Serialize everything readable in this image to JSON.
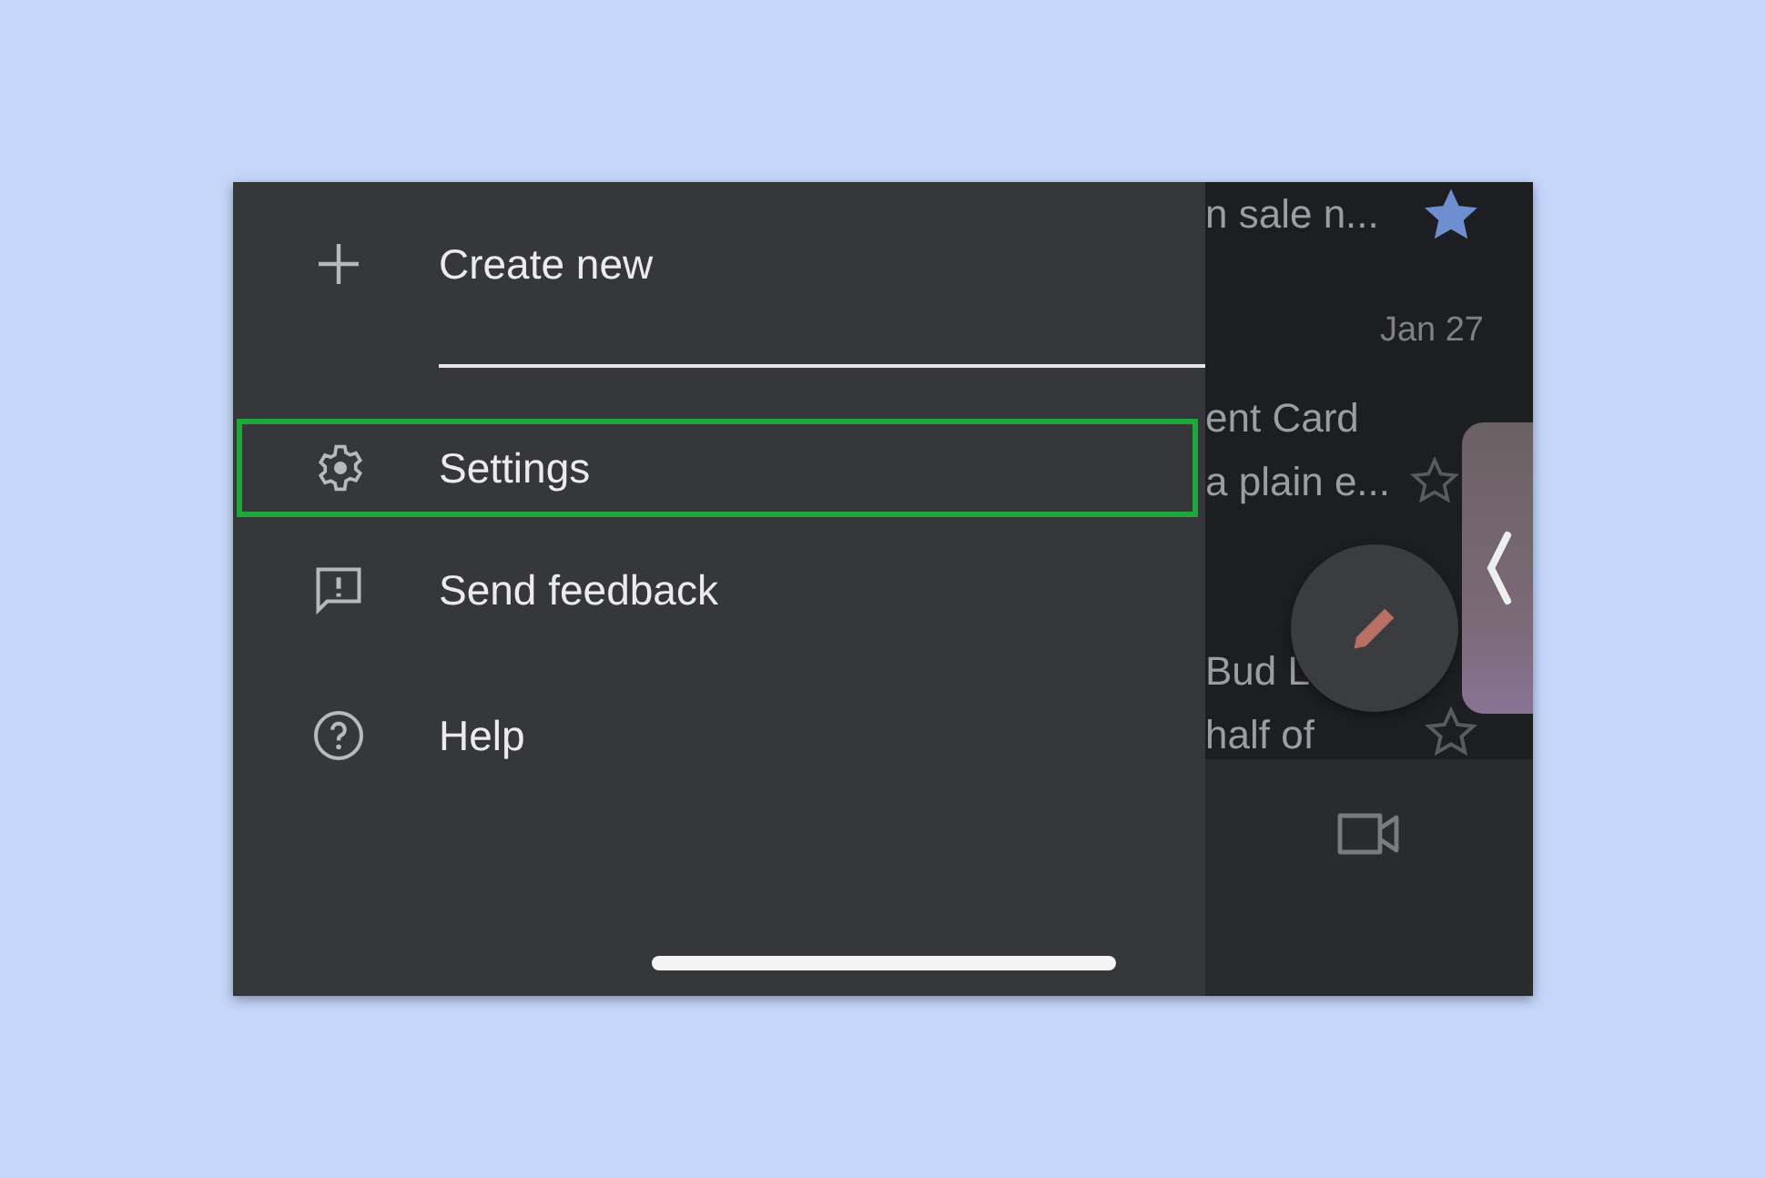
{
  "menu": [
    {
      "kind": "create",
      "label": "Create new",
      "highlighted": false
    },
    {
      "kind": "settings",
      "label": "Settings",
      "highlighted": true
    },
    {
      "kind": "feedback",
      "label": "Send feedback",
      "highlighted": false
    },
    {
      "kind": "help",
      "label": "Help",
      "highlighted": false
    }
  ],
  "emails": [
    {
      "snippet": "n sale n...",
      "starred": true
    },
    {
      "date": "Jan 27",
      "subject": "ent Card",
      "snippet": "a plain e...",
      "starred": false
    },
    {
      "subject": "Bud L",
      "snippet": "half of",
      "starred": false
    }
  ]
}
